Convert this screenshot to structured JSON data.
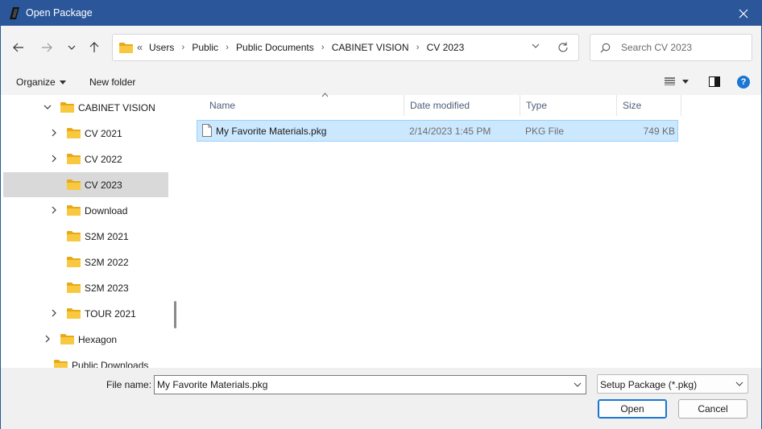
{
  "window": {
    "title": "Open Package"
  },
  "nav": {
    "back_icon": "arrow-left-icon",
    "forward_icon": "arrow-right-icon",
    "recent_icon": "chevron-down-icon",
    "up_icon": "arrow-up-icon"
  },
  "address": {
    "overflow": "«",
    "crumbs": [
      "Users",
      "Public",
      "Public Documents",
      "CABINET VISION",
      "CV 2023"
    ],
    "separator": "›"
  },
  "search": {
    "placeholder": "Search CV 2023",
    "value": ""
  },
  "toolbar": {
    "organize_label": "Organize",
    "new_folder_label": "New folder",
    "help_label": "?"
  },
  "tree": {
    "items": [
      {
        "label": "CABINET VISION",
        "expanded": true
      },
      {
        "label": "CV 2021",
        "expanded": false
      },
      {
        "label": "CV 2022",
        "expanded": false
      },
      {
        "label": "CV 2023",
        "selected": true
      },
      {
        "label": "Download",
        "expanded": false
      },
      {
        "label": "S2M 2021"
      },
      {
        "label": "S2M 2022"
      },
      {
        "label": "S2M 2023"
      },
      {
        "label": "TOUR 2021",
        "expanded": false
      },
      {
        "label": "Hexagon",
        "expanded": false
      },
      {
        "label": "Public Downloads"
      }
    ]
  },
  "columns": {
    "name": "Name",
    "date": "Date modified",
    "type": "Type",
    "size": "Size"
  },
  "files": [
    {
      "name": "My Favorite Materials.pkg",
      "date": "2/14/2023 1:45 PM",
      "type": "PKG File",
      "size": "749 KB"
    }
  ],
  "footer": {
    "file_name_label": "File name:",
    "file_name_value": "My Favorite Materials.pkg",
    "file_type_value": "Setup Package (*.pkg)",
    "open_label": "Open",
    "cancel_label": "Cancel"
  },
  "colors": {
    "titlebar": "#2b579a",
    "selection": "#cce8ff",
    "folder": "#f8c940",
    "accent": "#1976d2"
  }
}
